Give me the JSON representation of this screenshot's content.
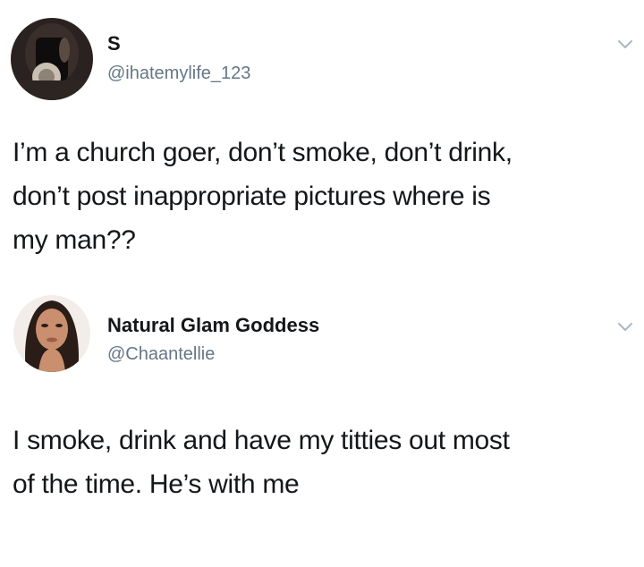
{
  "tweets": [
    {
      "name": "S",
      "handle": "@ihatemylife_123",
      "text": "I’m a church goer, don’t smoke, don’t drink,\ndon’t post inappropriate pictures where is\nmy man??",
      "avatar_icon": "profile-photo",
      "menu_icon": "chevron-down-icon"
    },
    {
      "name": "Natural Glam Goddess",
      "handle": "@Chaantellie",
      "text": "I smoke, drink and have my titties out most\nof the time. He’s with me",
      "avatar_icon": "profile-photo",
      "menu_icon": "chevron-down-icon"
    }
  ],
  "colors": {
    "background": "#ffffff",
    "text": "#14171a",
    "secondary": "#657786",
    "chevron": "#aab8c2"
  }
}
